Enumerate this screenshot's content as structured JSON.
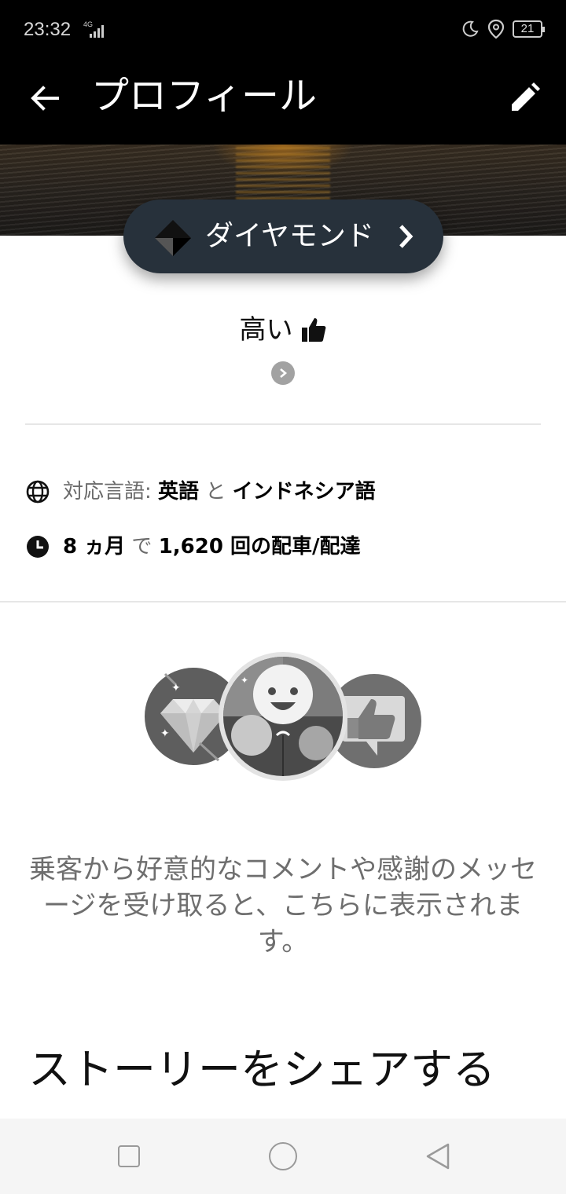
{
  "status_bar": {
    "time": "23:32",
    "network": "4G",
    "battery": "21",
    "icons": [
      "moon-icon",
      "location-icon",
      "battery-icon"
    ]
  },
  "app_bar": {
    "title": "プロフィール",
    "back_icon": "arrow-left-icon",
    "edit_icon": "pencil-icon"
  },
  "tier": {
    "label": "ダイヤモンド",
    "icon": "diamond-tier-icon",
    "chevron_icon": "chevron-right-icon"
  },
  "rating": {
    "text": "高い",
    "icon": "thumbs-up-icon",
    "more_icon": "chevron-right-circle-icon"
  },
  "languages": {
    "label": "対応言語:",
    "first": "英語",
    "conjunction": "と",
    "second": "インドネシア語",
    "icon": "globe-icon"
  },
  "trips": {
    "duration": "8 ヵ月",
    "connector": "で",
    "count": "1,620 回の配車/配達",
    "icon": "clock-icon"
  },
  "compliments": {
    "icons": [
      "diamond-badge-icon",
      "smiley-badge-icon",
      "thumbs-up-badge-icon"
    ],
    "empty_message": "乗客から好意的なコメントや感謝のメッセージを受け取ると、こちらに表示されます。"
  },
  "share": {
    "title": "ストーリーをシェアする"
  },
  "nav_bar": {
    "icons": [
      "recent-apps-icon",
      "home-icon",
      "back-triangle-icon"
    ]
  }
}
